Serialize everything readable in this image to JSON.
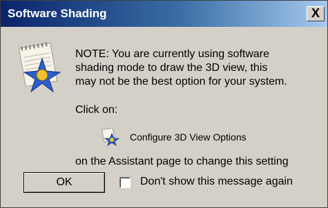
{
  "dialog": {
    "title": "Software Shading",
    "close_glyph": "X"
  },
  "message": {
    "line1": "NOTE: You are currently using software",
    "line2": "shading mode to draw the 3D view, this",
    "line3": "may not be the best option for your system."
  },
  "click_on": "Click on:",
  "configure_link": "Configure 3D View Options",
  "assistant_text": "on the Assistant page to change this setting",
  "ok_label": "OK",
  "dont_show_label": "Don't show this message again",
  "dont_show_checked": false,
  "icons": {
    "main": "notepad-star-icon",
    "link": "configure-3d-view-icon"
  },
  "colors": {
    "title_start": "#0a246a",
    "title_end": "#a6caf0",
    "face": "#d4d0c8"
  }
}
